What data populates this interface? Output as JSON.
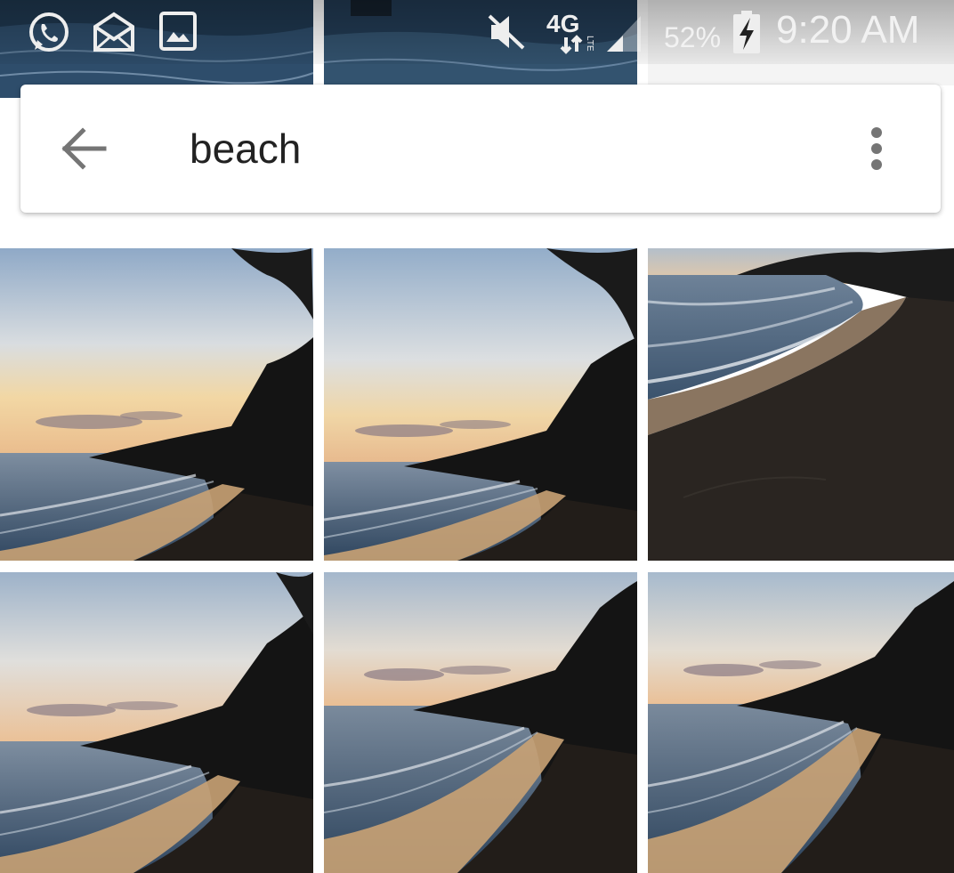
{
  "status_bar": {
    "battery": "52%",
    "time": "9:20 AM",
    "network": "4G",
    "network_sub": "LTE",
    "notification_icons": [
      "whatsapp-icon",
      "email-icon",
      "image-icon"
    ],
    "system_icons": [
      "vibrate-mute-icon",
      "4g-lte-icon",
      "signal-icon",
      "battery-charging-icon"
    ]
  },
  "search": {
    "query": "beach",
    "back_icon": "arrow-back-icon",
    "menu_icon": "more-vert-icon"
  },
  "results": {
    "count_visible": 6,
    "items": [
      {
        "name": "beach-photo-1",
        "scene": "sunset-cove"
      },
      {
        "name": "beach-photo-2",
        "scene": "sunset-cove"
      },
      {
        "name": "beach-photo-3",
        "scene": "sand-shoreline"
      },
      {
        "name": "beach-photo-4",
        "scene": "sunset-cove"
      },
      {
        "name": "beach-photo-5",
        "scene": "sunset-cove"
      },
      {
        "name": "beach-photo-6",
        "scene": "sunset-cove"
      }
    ]
  },
  "colors": {
    "sky_top": "#8aa6c4",
    "sky_glow": "#f3d9a8",
    "sea": "#3f5670",
    "sand": "#2b2622",
    "card": "#ffffff",
    "text": "#222222",
    "icon_grey": "#757575"
  }
}
